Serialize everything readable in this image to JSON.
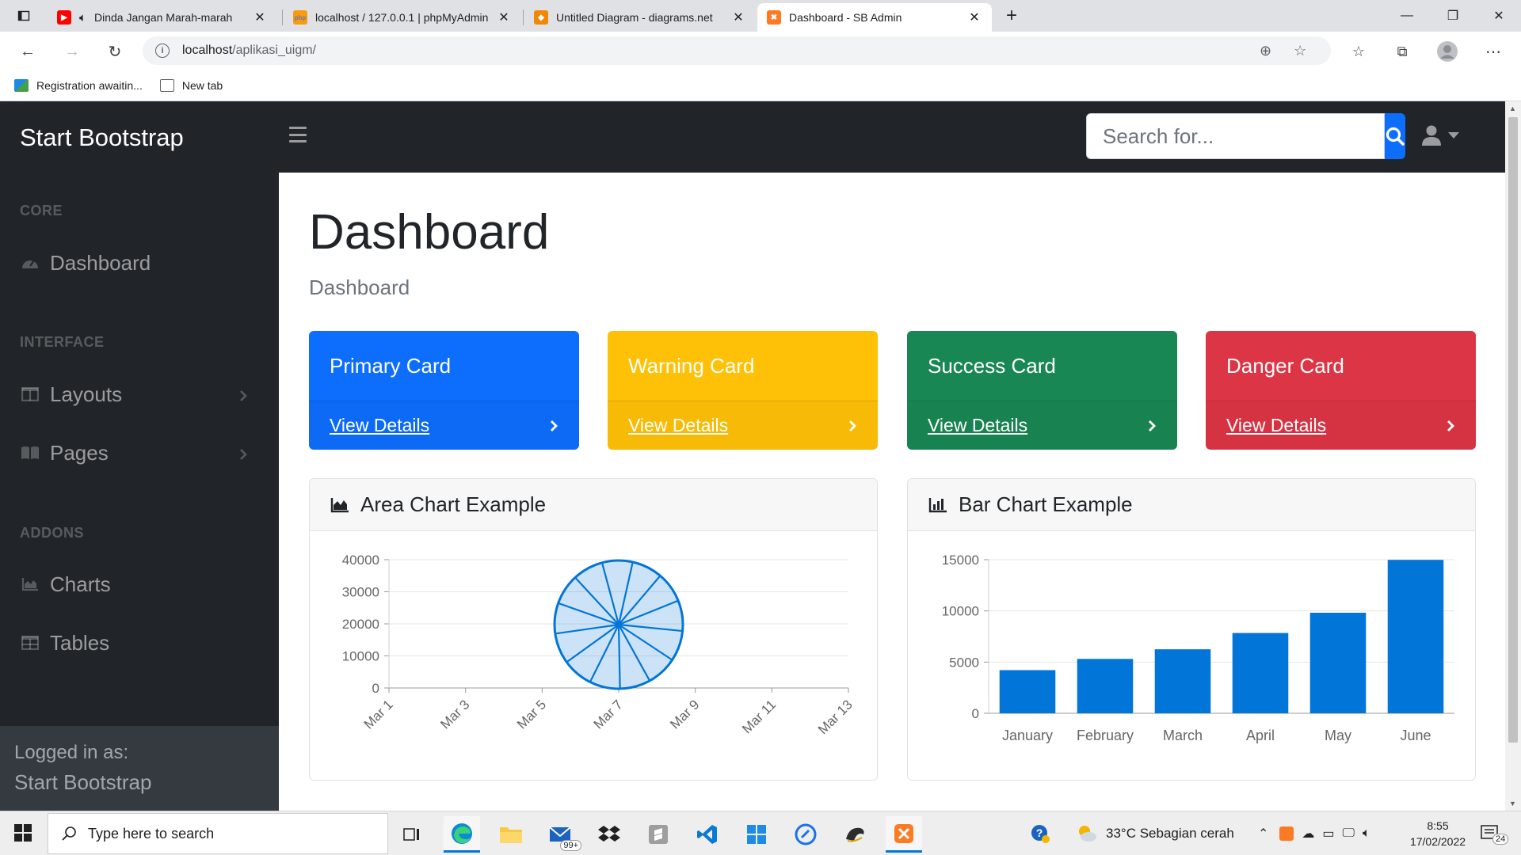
{
  "browser": {
    "tabs": [
      {
        "title": "Dinda Jangan Marah-marah",
        "favicon": "youtube-icon"
      },
      {
        "title": "localhost / 127.0.0.1 | phpMyAdmin",
        "favicon": "phpmyadmin-icon"
      },
      {
        "title": "Untitled Diagram - diagrams.net",
        "favicon": "drawio-icon"
      },
      {
        "title": "Dashboard - SB Admin",
        "favicon": "xampp-icon"
      }
    ],
    "address": {
      "host": "localhost",
      "path": "/aplikasi_uigm/"
    },
    "bookmarks": [
      {
        "label": "Registration awaitin..."
      },
      {
        "label": "New tab"
      }
    ]
  },
  "app": {
    "brand": "Start Bootstrap",
    "search": {
      "placeholder": "Search for...",
      "value": ""
    }
  },
  "sidebar": {
    "headings": [
      "CORE",
      "INTERFACE",
      "ADDONS"
    ],
    "items": [
      {
        "label": "Dashboard",
        "icon": "tachometer-icon"
      },
      {
        "label": "Layouts",
        "icon": "columns-icon"
      },
      {
        "label": "Pages",
        "icon": "book-icon"
      },
      {
        "label": "Charts",
        "icon": "area-chart-icon"
      },
      {
        "label": "Tables",
        "icon": "table-icon"
      }
    ],
    "footer": {
      "label": "Logged in as:",
      "user": "Start Bootstrap"
    }
  },
  "main": {
    "title": "Dashboard",
    "breadcrumb": "Dashboard",
    "cards": [
      {
        "title": "Primary Card",
        "link": "View Details",
        "color": "#0d6efd"
      },
      {
        "title": "Warning Card",
        "link": "View Details",
        "color": "#ffc107"
      },
      {
        "title": "Success Card",
        "link": "View Details",
        "color": "#198754"
      },
      {
        "title": "Danger Card",
        "link": "View Details",
        "color": "#dc3545"
      }
    ],
    "area_chart_title": "Area Chart Example",
    "bar_chart_title": "Bar Chart Example"
  },
  "chart_data": [
    {
      "type": "area",
      "title": "Area Chart Example",
      "x_ticks": [
        "Mar 1",
        "Mar 3",
        "Mar 5",
        "Mar 7",
        "Mar 9",
        "Mar 11",
        "Mar 13"
      ],
      "y_ticks": [
        "0",
        "10000",
        "20000",
        "30000",
        "40000"
      ],
      "ylim": [
        0,
        40000
      ],
      "color": "#0275d8",
      "note_values": [],
      "grid": true
    },
    {
      "type": "bar",
      "title": "Bar Chart Example",
      "categories": [
        "January",
        "February",
        "March",
        "April",
        "May",
        "June"
      ],
      "values": [
        4215,
        5312,
        6251,
        7841,
        9821,
        14984
      ],
      "y_ticks": [
        "0",
        "5000",
        "10000",
        "15000"
      ],
      "ylim": [
        0,
        15000
      ],
      "color": "#0275d8",
      "grid": true
    }
  ],
  "taskbar": {
    "search_placeholder": "Type here to search",
    "weather": "33°C  Sebagian cerah",
    "time": "8:55",
    "date": "17/02/2022",
    "mail_badge": "99+",
    "notif_count": "24"
  }
}
